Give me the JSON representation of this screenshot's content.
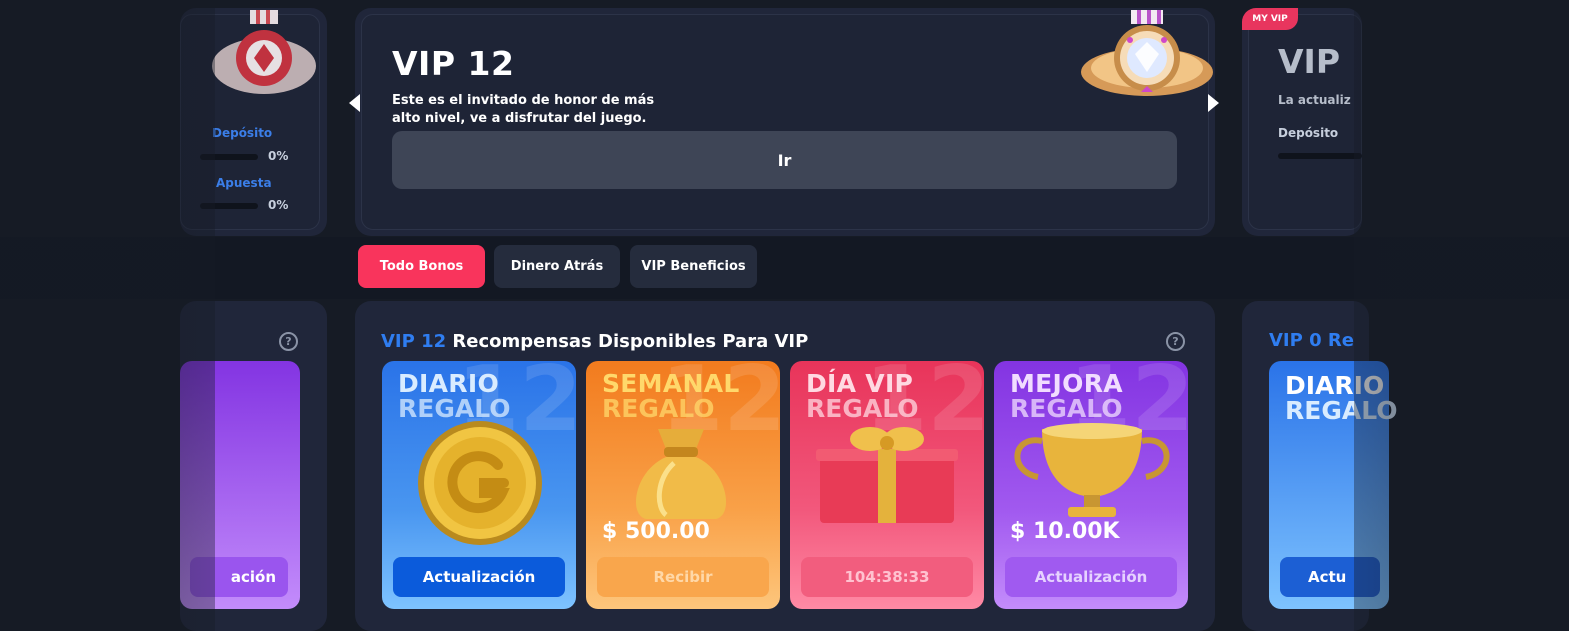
{
  "left_card": {
    "deposit_label": "Depósito",
    "deposit_pct": "0%",
    "bet_label": "Apuesta",
    "bet_pct": "0%"
  },
  "vip_card": {
    "title": "VIP 12",
    "description_line1": "Este es el invitado de honor de más",
    "description_line2": "alto nivel, ve a disfrutar del juego.",
    "go_button": "Ir",
    "medal_icon": "diamond-medal-icon"
  },
  "right_card": {
    "badge": "MY VIP",
    "title": "VIP",
    "subtitle": "La actualiz",
    "deposit_label": "Depósito"
  },
  "tabs": [
    {
      "label": "Todo Bonos",
      "active": true
    },
    {
      "label": "Dinero Atrás",
      "active": false
    },
    {
      "label": "VIP Beneficios",
      "active": false
    }
  ],
  "rewards": {
    "heading_level": "VIP 12",
    "heading_text": "Recompensas Disponibles Para VIP",
    "cards": [
      {
        "title": "DIARIO",
        "subtitle": "REGALO",
        "amount": "",
        "button": "Actualización",
        "icon": "gold-coin-icon"
      },
      {
        "title": "SEMANAL",
        "subtitle": "REGALO",
        "amount": "$ 500.00",
        "button": "Recibir",
        "icon": "money-bag-icon"
      },
      {
        "title": "DÍA VIP",
        "subtitle": "REGALO",
        "amount": "",
        "button": "104:38:33",
        "icon": "gift-box-icon"
      },
      {
        "title": "MEJORA",
        "subtitle": "REGALO",
        "amount": "$ 10.00K",
        "button": "Actualización",
        "icon": "trophy-icon"
      }
    ]
  },
  "side_rewards": {
    "left_button": "ación",
    "right_heading": "VIP 0 Re",
    "right_title": "DIARIO",
    "right_subtitle": "REGALO",
    "right_button": "Actu"
  },
  "colors": {
    "background": "#161b25",
    "card": "#20263a",
    "accent_pink": "#f9345c",
    "accent_blue": "#2f7df0"
  }
}
